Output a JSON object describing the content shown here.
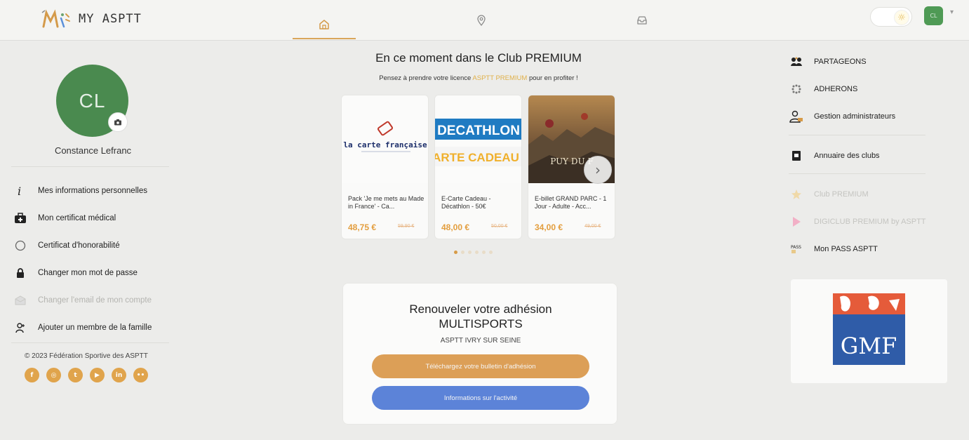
{
  "header": {
    "logo_text": "MY ASPTT",
    "nav": [
      {
        "name": "home",
        "icon": "home-icon",
        "active": true
      },
      {
        "name": "map",
        "icon": "map-pin-icon",
        "active": false
      },
      {
        "name": "inbox",
        "icon": "inbox-icon",
        "active": false
      }
    ],
    "theme_icon": "sun-icon",
    "user_initials": "CL",
    "caret": "▾"
  },
  "profile": {
    "initials": "CL",
    "name": "Constance Lefranc"
  },
  "left_menu": [
    {
      "label": "Mes informations personnelles",
      "icon": "info-icon",
      "disabled": false
    },
    {
      "label": "Mon certificat médical",
      "icon": "medical-bag-icon",
      "disabled": false
    },
    {
      "label": "Certificat d'honorabilité",
      "icon": "circle-icon",
      "disabled": false
    },
    {
      "label": "Changer mon mot de passe",
      "icon": "lock-icon",
      "disabled": false
    },
    {
      "label": "Changer l'email de mon compte",
      "icon": "mail-icon",
      "disabled": true
    },
    {
      "label": "Ajouter un membre de la famille",
      "icon": "user-add-icon",
      "disabled": false
    }
  ],
  "footer": {
    "copyright": "© 2023 Fédération Sportive des ASPTT",
    "socials": [
      "facebook-icon",
      "instagram-icon",
      "twitter-icon",
      "youtube-icon",
      "linkedin-icon",
      "flickr-icon"
    ]
  },
  "premium": {
    "title": "En ce moment dans le Club PREMIUM",
    "subtitle_before": "Pensez à prendre votre licence ",
    "subtitle_highlight": "ASPTT PREMIUM",
    "subtitle_after": " pour en profiter !",
    "cards": [
      {
        "name": "Pack 'Je me mets au Made in France' - Ca...",
        "price": "48,75 €",
        "old_price": "59,90 €",
        "brand": "la carte française"
      },
      {
        "name": "E-Carte Cadeau - Décathlon - 50€",
        "price": "48,00 €",
        "old_price": "50,00 €",
        "brand_top": "DECATHLON",
        "brand_bottom": "ARTE CADEAU"
      },
      {
        "name": "E-billet GRAND PARC - 1 Jour - Adulte - Acc...",
        "price": "34,00 €",
        "old_price": "49,00 €",
        "brand": "PUY DU F"
      }
    ],
    "next_icon": "›",
    "dots": 6,
    "active_dot": 0
  },
  "renew": {
    "title_line1": "Renouveler votre adhésion",
    "title_line2": "MULTISPORTS",
    "club": "ASPTT IVRY SUR SEINE",
    "download_label": "Téléchargez votre bulletin d'adhésion",
    "info_label": "Informations sur l'activité"
  },
  "right_menu": [
    {
      "label": "PARTAGEONS",
      "icon": "handshake-icon",
      "dim": false
    },
    {
      "label": "ADHERONS",
      "icon": "dots-grid-icon",
      "dim": false
    },
    {
      "label": "Gestion administrateurs",
      "icon": "admin-user-icon",
      "dim": false
    },
    {
      "label": "Annuaire des clubs",
      "icon": "book-icon",
      "dim": false
    },
    {
      "label": "Club PREMIUM",
      "icon": "star-icon",
      "dim": true
    },
    {
      "label": "DIGICLUB PREMIUM by ASPTT",
      "icon": "play-icon",
      "dim": true
    },
    {
      "label": "Mon PASS ASPTT",
      "icon": "pass-icon",
      "dim": false
    }
  ],
  "sponsor": {
    "name": "GMF"
  },
  "colors": {
    "accent_orange": "#dc9f57",
    "accent_blue": "#5c83d8",
    "avatar_green": "#4a8a4f"
  }
}
